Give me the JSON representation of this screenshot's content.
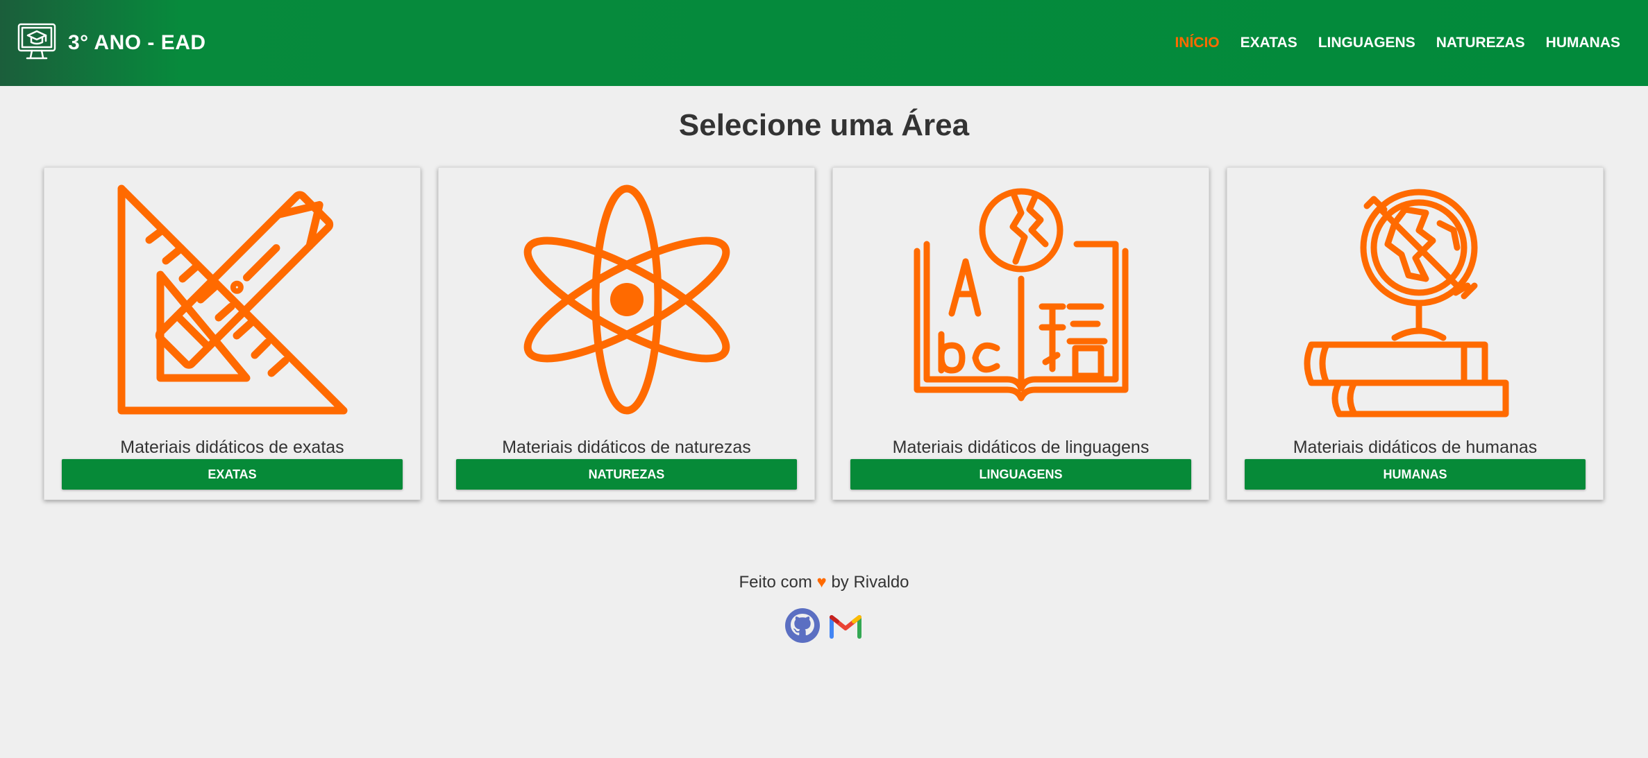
{
  "header": {
    "title": "3° ANO - EAD",
    "nav": [
      {
        "label": "INÍCIO",
        "active": true
      },
      {
        "label": "EXATAS"
      },
      {
        "label": "LINGUAGENS"
      },
      {
        "label": "NATUREZAS"
      },
      {
        "label": "HUMANAS"
      }
    ]
  },
  "main": {
    "title": "Selecione uma Área",
    "cards": [
      {
        "description": "Materiais didáticos de exatas",
        "button": "EXATAS",
        "icon": "ruler-triangle-icon"
      },
      {
        "description": "Materiais didáticos de naturezas",
        "button": "NATUREZAS",
        "icon": "atom-icon"
      },
      {
        "description": "Materiais didáticos de linguagens",
        "button": "LINGUAGENS",
        "icon": "book-globe-icon"
      },
      {
        "description": "Materiais didáticos de humanas",
        "button": "HUMANAS",
        "icon": "globe-books-icon"
      }
    ]
  },
  "footer": {
    "made_with": "Feito com",
    "heart": "♥",
    "by": "by Rivaldo",
    "icons": [
      "github-icon",
      "gmail-icon"
    ]
  },
  "colors": {
    "accent": "#ff6a00",
    "primary": "#068a38",
    "background": "#efefef"
  }
}
